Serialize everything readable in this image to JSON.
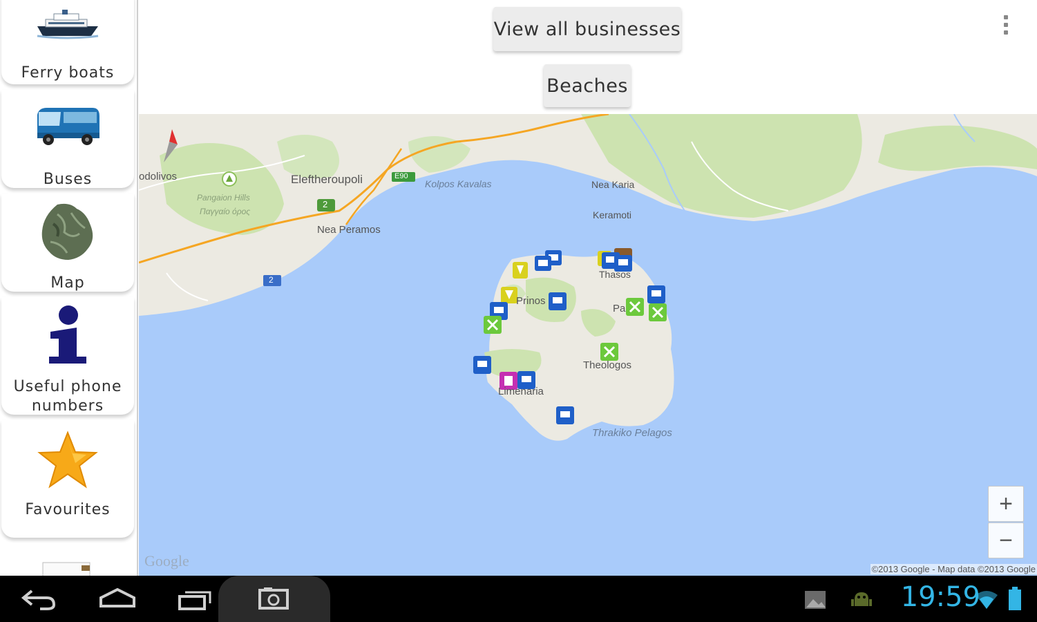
{
  "sidebar": {
    "items": [
      {
        "label": "Ferry boats",
        "icon": "ferry-icon"
      },
      {
        "label": "Buses",
        "icon": "bus-icon"
      },
      {
        "label": "Map",
        "icon": "island-map-icon"
      },
      {
        "label": "Useful phone numbers",
        "label_line1": "Useful phone",
        "label_line2": "numbers",
        "icon": "info-icon"
      },
      {
        "label": "Favourites",
        "icon": "star-icon"
      }
    ]
  },
  "header": {
    "view_all_label": "View all businesses",
    "beaches_label": "Beaches",
    "overflow_icon": "overflow-menu-icon"
  },
  "map": {
    "labels": {
      "prodolivos": "odolivos",
      "eleftheroupoli": "Eleftheroupoli",
      "pangaion": "Pangaion Hills",
      "pangaion_greek": "Παγγαίο όρος",
      "nea_peramos": "Nea Peramos",
      "kolpos": "Kolpos Kavalas",
      "nea_karia": "Nea Karia",
      "keramoti": "Keramoti",
      "thasos": "Thasos",
      "prinos": "Prinos",
      "panagia": "Pa",
      "theologos": "Theologos",
      "limenaria": "Limenaria",
      "thrakiko": "Thrakiko Pelagos",
      "road_e90": "E90",
      "road_2a": "2",
      "road_2b": "2"
    },
    "zoom_in": "+",
    "zoom_out": "−",
    "google_logo": "Google",
    "attribution": "©2013 Google - Map data ©2013 Google",
    "colors": {
      "sea": "#a9cbfa",
      "land": "#eceae2",
      "park": "#cde3b0",
      "road": "#f5a623",
      "marker_blue": "#1f5fc8",
      "marker_green": "#6cc93c",
      "marker_yellow": "#d9d11e",
      "marker_magenta": "#c52fb2",
      "marker_brown": "#8a5a2a"
    }
  },
  "system_bar": {
    "time": "19:59",
    "icons": [
      "back-icon",
      "home-icon",
      "recent-apps-icon",
      "screenshot-icon",
      "gallery-icon",
      "android-debug-icon",
      "wifi-icon",
      "battery-icon"
    ]
  }
}
